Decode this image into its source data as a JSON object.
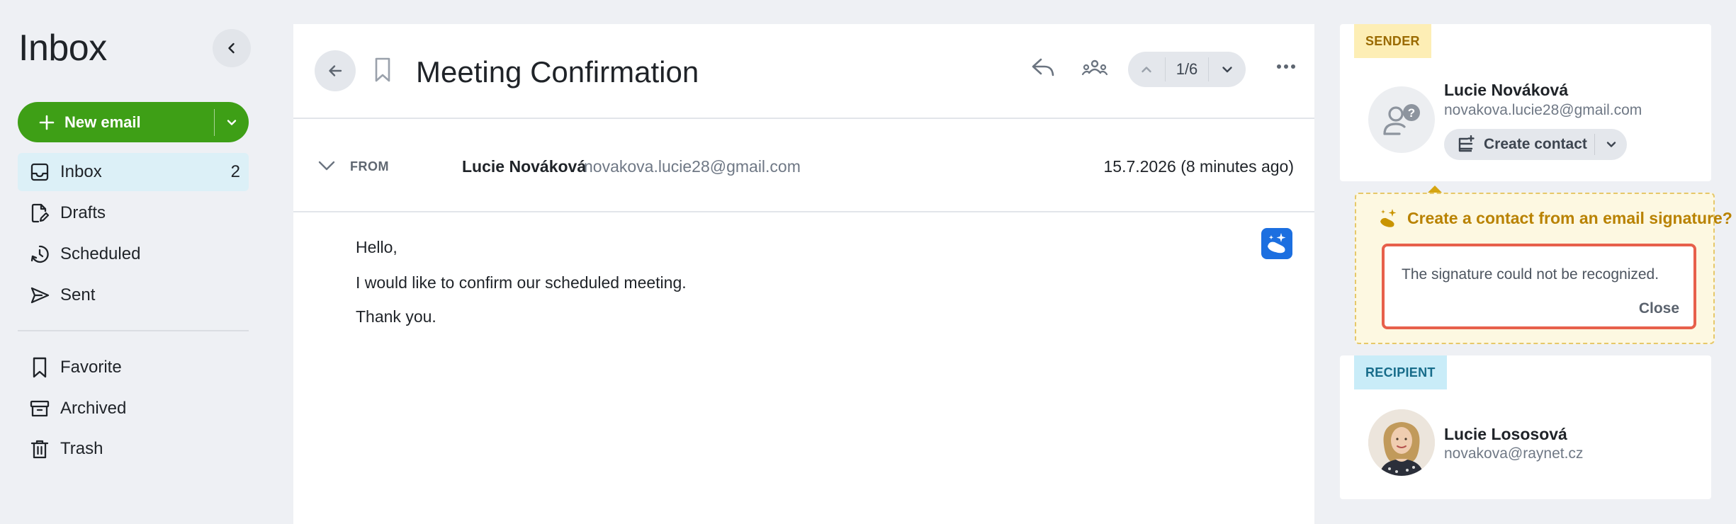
{
  "sidebar": {
    "title": "Inbox",
    "new_email_label": "New email",
    "items": [
      {
        "label": "Inbox",
        "count": "2"
      },
      {
        "label": "Drafts"
      },
      {
        "label": "Scheduled"
      },
      {
        "label": "Sent"
      },
      {
        "label": "Favorite"
      },
      {
        "label": "Archived"
      },
      {
        "label": "Trash"
      }
    ]
  },
  "email": {
    "subject": "Meeting Confirmation",
    "pager": "1/6",
    "from_label": "FROM",
    "from_name": "Lucie Nováková",
    "from_email": "novakova.lucie28@gmail.com",
    "date": "15.7.2026 (8 minutes ago)",
    "body": [
      "Hello,",
      "I would like to confirm our scheduled meeting.",
      "Thank you."
    ]
  },
  "sender": {
    "badge": "SENDER",
    "name": "Lucie Nováková",
    "email": "novakova.lucie28@gmail.com",
    "create_contact_label": "Create contact"
  },
  "popup": {
    "title": "Create a contact from an email signature?",
    "message": "The signature could not be recognized.",
    "close_label": "Close"
  },
  "recipient": {
    "badge": "RECIPIENT",
    "name": "Lucie Lososová",
    "email": "novakova@raynet.cz"
  },
  "colors": {
    "primary_green": "#3e9f16",
    "active_nav_bg": "#dcf0f7",
    "sender_badge_bg": "#fdeeb5",
    "recipient_badge_bg": "#c9ecf8",
    "popup_accent": "#b98200",
    "error_border": "#e7604b",
    "ai_button": "#1c6fe0"
  },
  "icons": {
    "collapse": "chevron-left-icon",
    "new_email": "plus-icon",
    "inbox": "inbox-tray-icon",
    "drafts": "document-pen-icon",
    "scheduled": "clock-arrow-icon",
    "sent": "send-arrow-icon",
    "favorite": "bookmark-icon",
    "archived": "archive-box-icon",
    "trash": "trash-icon",
    "back": "arrow-left-icon",
    "reply": "reply-icon",
    "people": "people-icon",
    "more": "more-horizontal-icon",
    "ai": "ai-sparkle-icon",
    "sparkle": "sparkle-icon",
    "unknown_contact": "unknown-person-icon",
    "add_contact": "add-contact-icon"
  }
}
